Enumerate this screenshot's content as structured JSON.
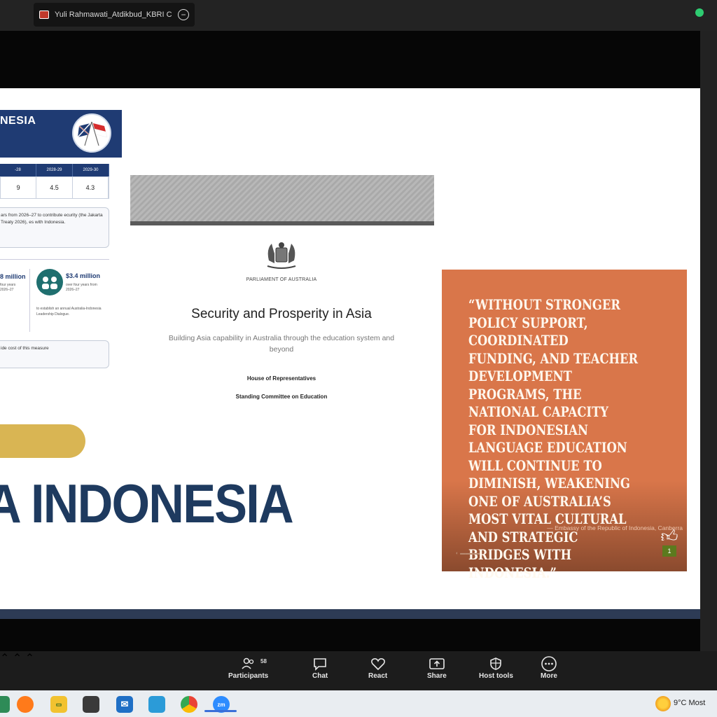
{
  "window": {
    "share_tab_label": "Yuli Rahmawati_Atdikbud_KBRI C",
    "status_color": "#2ecc71"
  },
  "slide": {
    "left_panel": {
      "header_text": "NESIA",
      "table_headers": [
        "-28",
        "2028-29",
        "2029-30"
      ],
      "table_values": [
        "9",
        "4.5",
        "4.3"
      ],
      "info_text": "ars from 2026–27 to contribute ecurity (the Jakarta Treaty 2026), es with Indonesia.",
      "stat1_value": "8 million",
      "stat1_sub": "four years 2026–27",
      "stat2_value": "$3.4 million",
      "stat2_sub": "over four years from 2026–27",
      "stat2_desc": "to establish an annual Australia-Indonesia Leadership Dialogue.",
      "info2_text": "ide cost of this measure",
      "big_text": "A INDONESIA"
    },
    "document": {
      "parliament": "PARLIAMENT OF AUSTRALIA",
      "title": "Security and Prosperity in Asia",
      "subtitle": "Building Asia capability in Australia through the education system and beyond",
      "house": "House of Representatives",
      "committee": "Standing Committee on Education"
    },
    "quote_card": {
      "quote": "“Without stronger policy support, coordinated funding, and teacher development programs, the national capacity for Indonesian language education will continue to diminish, weakening one of Australia’s most vital cultural and strategic bridges with Indonesia.”",
      "attribution": "— Embassy of the Republic of Indonesia, Canberra",
      "badge": "1"
    }
  },
  "toolbar": {
    "participants_label": "Participants",
    "participants_count": "58",
    "chat_label": "Chat",
    "react_label": "React",
    "share_label": "Share",
    "host_tools_label": "Host tools",
    "more_label": "More"
  },
  "taskbar": {
    "weather": "9°C  Most"
  },
  "colors": {
    "slide_navy": "#1f3b73",
    "quote_orange": "#d9764a",
    "pill_gold": "#d9b553"
  }
}
